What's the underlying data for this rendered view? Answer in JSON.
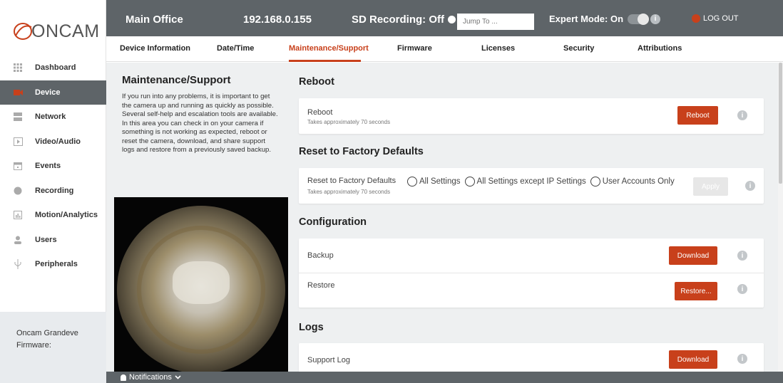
{
  "brand": {
    "logo_text": "ONCAM",
    "accent_color": "#c8401b",
    "topbar_color": "#5e6468"
  },
  "topbar": {
    "location": "Main Office",
    "ip": "192.168.0.155",
    "sd_recording": "SD Recording: Off",
    "jump_placeholder": "Jump To ...",
    "expert_mode": "Expert Mode: On",
    "logout": "LOG OUT"
  },
  "tabs": [
    {
      "label": "Device Information"
    },
    {
      "label": "Date/Time"
    },
    {
      "label": "Maintenance/Support",
      "active": true
    },
    {
      "label": "Firmware"
    },
    {
      "label": "Licenses"
    },
    {
      "label": "Security"
    },
    {
      "label": "Attributions"
    }
  ],
  "sidebar": {
    "items": [
      {
        "label": "Dashboard",
        "icon": "grid-icon"
      },
      {
        "label": "Device",
        "icon": "camera-icon",
        "active": true
      },
      {
        "label": "Network",
        "icon": "network-icon"
      },
      {
        "label": "Video/Audio",
        "icon": "play-icon"
      },
      {
        "label": "Events",
        "icon": "calendar-icon"
      },
      {
        "label": "Recording",
        "icon": "record-icon"
      },
      {
        "label": "Motion/Analytics",
        "icon": "chart-icon"
      },
      {
        "label": "Users",
        "icon": "user-icon"
      },
      {
        "label": "Peripherals",
        "icon": "usb-icon"
      }
    ],
    "footer": {
      "model": "Oncam Grandeve",
      "firmware_label": "Firmware:"
    }
  },
  "info_panel": {
    "title": "Maintenance/Support",
    "text": "If you run into any problems, it is important to get the camera up and running as quickly as possible. Several self-help and escalation tools are available. In this area you can check in on your camera if something is not working as expected, reboot or reset the camera, download, and share support logs and restore from a previously saved backup."
  },
  "sections": {
    "reboot": {
      "title": "Reboot",
      "label": "Reboot",
      "sub": "Takes approximately 70 seconds",
      "button": "Reboot"
    },
    "reset": {
      "title": "Reset to Factory Defaults",
      "label": "Reset to Factory Defaults",
      "sub": "Takes approximately 70 seconds",
      "options": [
        "All Settings",
        "All Settings except IP Settings",
        "User Accounts Only"
      ],
      "button": "Apply"
    },
    "configuration": {
      "title": "Configuration",
      "backup_label": "Backup",
      "backup_button": "Download",
      "restore_label": "Restore",
      "restore_button": "Restore..."
    },
    "logs": {
      "title": "Logs",
      "support_label": "Support Log",
      "support_button": "Download"
    }
  },
  "notifications": {
    "label": "Notifications"
  },
  "info_glyph": "i"
}
